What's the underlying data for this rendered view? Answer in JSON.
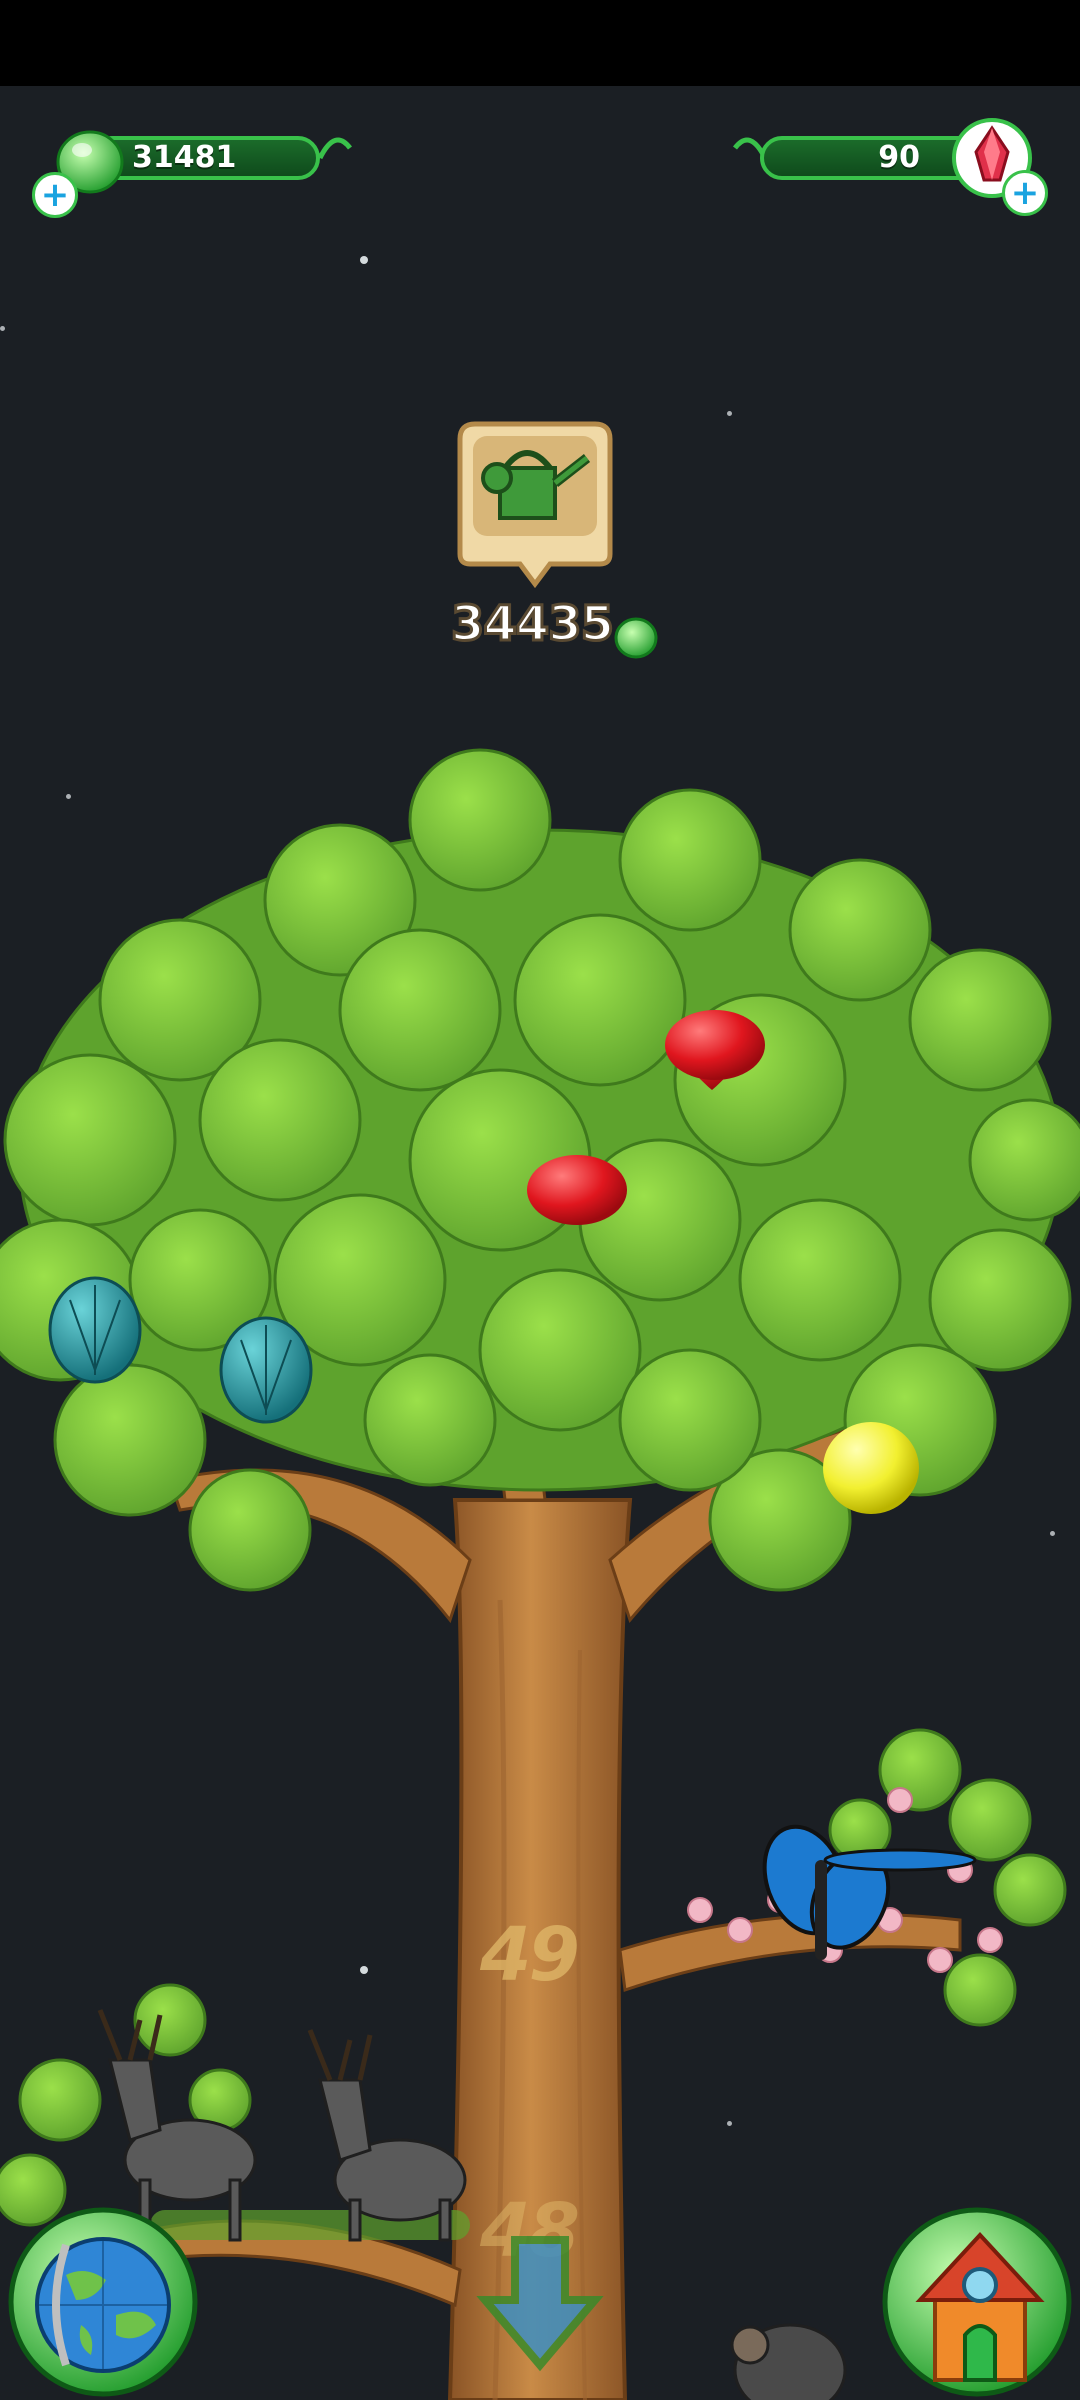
{
  "hud": {
    "gum_currency": {
      "value": "31481",
      "icon": "green-gumdrop-icon"
    },
    "gem_currency": {
      "value": "90",
      "icon": "red-crystal-icon"
    }
  },
  "price_tag": {
    "value": "34435",
    "icon": "watering-can-icon",
    "currency_icon": "green-gumdrop-icon"
  },
  "tree": {
    "fruits": [
      {
        "type": "red-heart-fruit"
      },
      {
        "type": "red-heart-fruit"
      },
      {
        "type": "teal-pinecone-fruit"
      },
      {
        "type": "teal-pinecone-fruit"
      },
      {
        "type": "yellow-lemon-fruit"
      }
    ],
    "level_markers": [
      "49",
      "48"
    ]
  },
  "bottom_nav": {
    "globe_button": "globe-icon",
    "scroll_down_button": "down-arrow-icon",
    "home_button": "house-icon"
  },
  "colors": {
    "background": "#1b1f24",
    "leaf": "#7bc43a",
    "trunk": "#b97a3a",
    "accent_green": "#39c14a"
  }
}
